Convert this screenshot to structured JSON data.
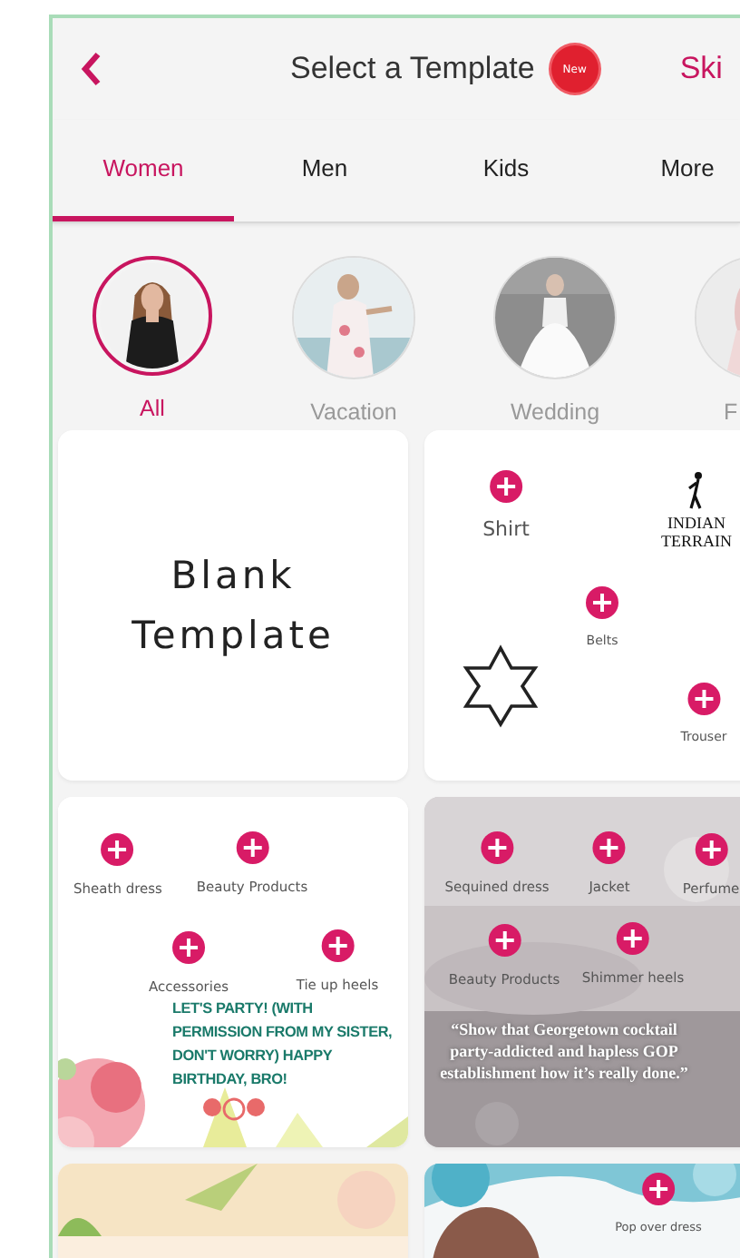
{
  "header": {
    "title": "Select a Template",
    "badge": "New",
    "action": "Ski"
  },
  "tabs": [
    {
      "label": "Women",
      "selected": true
    },
    {
      "label": "Men",
      "selected": false
    },
    {
      "label": "Kids",
      "selected": false
    },
    {
      "label": "More",
      "selected": false
    }
  ],
  "categories": [
    {
      "label": "All",
      "selected": true
    },
    {
      "label": "Vacation",
      "selected": false
    },
    {
      "label": "Wedding",
      "selected": false
    },
    {
      "label": "F",
      "selected": false
    }
  ],
  "templates": [
    {
      "kind": "blank",
      "title": "Blank Template"
    },
    {
      "kind": "canvas",
      "items": [
        {
          "kind": "plus",
          "label": "Shirt"
        },
        {
          "kind": "logo",
          "label": "INDIAN TERRAIN"
        },
        {
          "kind": "plus",
          "label": "Belts"
        },
        {
          "kind": "star"
        },
        {
          "kind": "plus",
          "label": "Trouser"
        }
      ]
    },
    {
      "kind": "picture",
      "caption": "LET'S PARTY! (WITH PERMISSION FROM MY SISTER, DON'T WORRY) HAPPY BIRTHDAY, BRO!",
      "items": [
        {
          "kind": "plus",
          "label": "Sheath dress"
        },
        {
          "kind": "plus",
          "label": "Beauty Products"
        },
        {
          "kind": "plus",
          "label": "Accessories"
        },
        {
          "kind": "plus",
          "label": "Tie up heels"
        },
        {
          "kind": "balloons"
        }
      ]
    },
    {
      "kind": "picture",
      "caption": "“Show that Georgetown cocktail party-addicted and hapless GOP establishment how it’s really done.”",
      "items": [
        {
          "kind": "plus",
          "label": "Sequined dress"
        },
        {
          "kind": "plus",
          "label": "Jacket"
        },
        {
          "kind": "plus",
          "label": "Perfume"
        },
        {
          "kind": "plus",
          "label": "Beauty Products"
        },
        {
          "kind": "plus",
          "label": "Shimmer heels"
        }
      ]
    },
    {
      "kind": "picture"
    },
    {
      "kind": "picture",
      "items": [
        {
          "kind": "plus",
          "label": "Pop over dress"
        }
      ]
    }
  ]
}
